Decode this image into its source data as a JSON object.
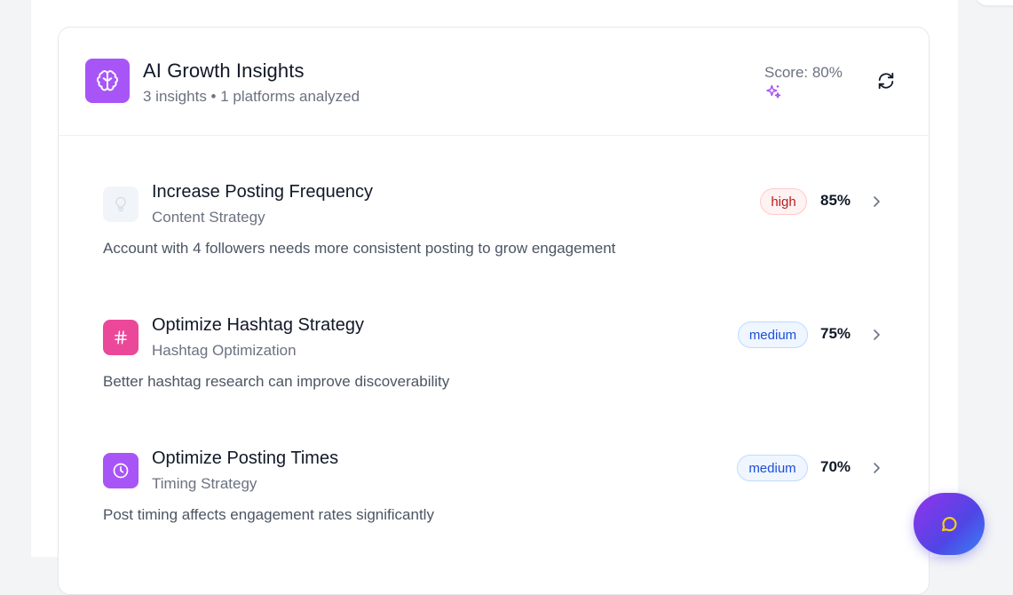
{
  "header": {
    "title": "AI Growth Insights",
    "subtitle": "3 insights • 1 platforms analyzed",
    "score": "Score: 80%",
    "icon": "brain-icon",
    "refresh_icon": "refresh-icon"
  },
  "insights": [
    {
      "title": "Increase Posting Frequency",
      "category": "Content Strategy",
      "description": "Account with 4 followers needs more consistent posting to grow engagement",
      "priority": "high",
      "confidence": "85%",
      "icon": "lightbulb-icon"
    },
    {
      "title": "Optimize Hashtag Strategy",
      "category": "Hashtag Optimization",
      "description": "Better hashtag research can improve discoverability",
      "priority": "medium",
      "confidence": "75%",
      "icon": "hash-icon"
    },
    {
      "title": "Optimize Posting Times",
      "category": "Timing Strategy",
      "description": "Post timing affects engagement rates significantly",
      "priority": "medium",
      "confidence": "70%",
      "icon": "clock-icon"
    }
  ],
  "chat": {
    "icon": "chat-bubble-icon"
  },
  "colors": {
    "brand_purple": "#a855f7",
    "hashtag_pink": "#ec4899",
    "high_badge": "#b91c1c",
    "medium_badge": "#1d4ed8"
  }
}
